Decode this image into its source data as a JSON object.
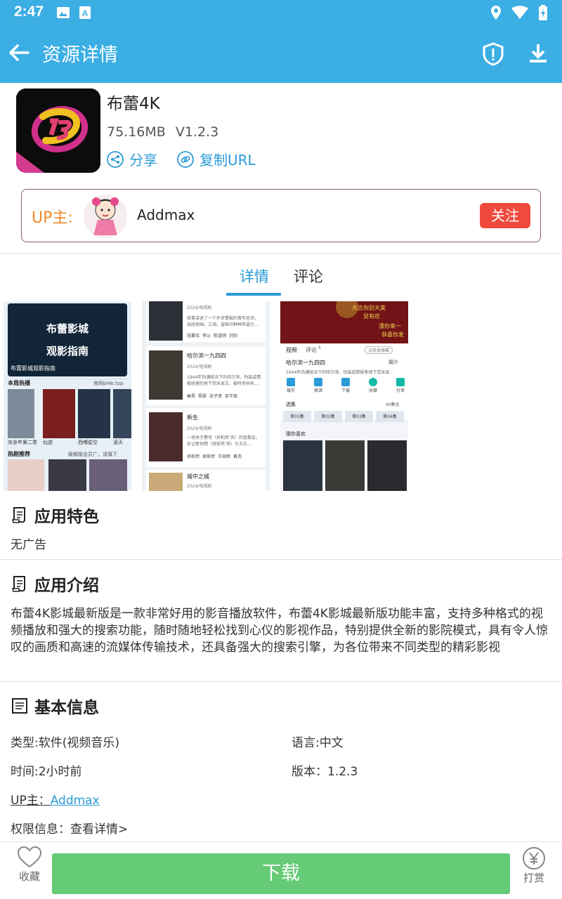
{
  "status_bar": {
    "time": "2:47"
  },
  "app_bar": {
    "title": "资源详情"
  },
  "app": {
    "name": "布蕾4K",
    "size": "75.16MB",
    "version": "V1.2.3",
    "share_label": "分享",
    "copy_url_label": "复制URL"
  },
  "uploader": {
    "label": "UP主:",
    "name": "Addmax",
    "follow_label": "关注"
  },
  "tabs": [
    {
      "label": "详情",
      "active": true
    },
    {
      "label": "评论",
      "active": false
    }
  ],
  "screenshots": {
    "shot1": {
      "banner_title": "布蕾影城",
      "banner_subtitle": "观影指南",
      "banner_caption": "布蕾影城观影指南",
      "hot_week": "本周热播",
      "site": "官网bl4k.top",
      "cards": [
        "庆余年第二季",
        "仙逆",
        "西嘈星空",
        "凌天"
      ],
      "recommend": "热剧推荐",
      "recommend_note": "破解版会员广，请慎下"
    },
    "shot2": {
      "items": [
        {
          "title": "",
          "meta": "2024/电视剧",
          "desc": "故事讲述了一个外世情报的青年总司，品经家国。江湖、盗匪间种种带盗引…",
          "tags": [
            "张翼伟",
            "李沁",
            "陈道明",
            "刘钧"
          ]
        },
        {
          "title": "哈尔滨一九四四",
          "meta": "2024/电视剧",
          "desc": "1944年伪满统治下的哈尔滨，伪装成情报经营的地下党宋卓文，被特务科科…",
          "tags": [
            "秦昊",
            "杨翠",
            "张子贤",
            "吴芊辰"
          ]
        },
        {
          "title": "新生",
          "meta": "2024/电视剧",
          "desc": "一场关于费可（井柏然 饰）的追悬会。女记者何晴（周依然 饰）与五位…",
          "tags": [
            "井柏然",
            "周依然",
            "王砚辉",
            "黄尧"
          ]
        },
        {
          "title": "城中之城",
          "meta": "2024/电视剧",
          "desc": "",
          "tags": []
        }
      ]
    },
    "shot3": {
      "danmaku": [
        "大吉你别大美",
        "吴有欢",
        "漂你来一",
        "恭喜你发"
      ],
      "tab_video": "视频",
      "tab_comment": "评论",
      "comment_count": "5",
      "danmaku_btn": "点我发弹幕",
      "title": "哈尔滨一九四四",
      "intro_label": "简介",
      "desc": "1944年伪满统治下的哈尔滨，伪装成情报者地下党宋卓…",
      "actions": [
        "缓存",
        "换源",
        "下载",
        "收藏",
        "分享"
      ],
      "episodes_label": "选集",
      "episodes_total": "40集全",
      "episodes": [
        "第01集",
        "第02集",
        "第03集",
        "第04集"
      ],
      "guess_label": "猜你喜欢"
    }
  },
  "features": {
    "title": "应用特色",
    "text": "无广告"
  },
  "intro": {
    "title": "应用介绍",
    "text": "布蕾4K影城最新版是一款非常好用的影音播放软件，布蕾4K影城最新版功能丰富，支持多种格式的视频播放和强大的搜索功能，随时随地轻松找到心仪的影视作品，特别提供全新的影院模式，具有令人惊叹的画质和高速的流媒体传输技术，还具备强大的搜索引擎，为各位带来不同类型的精彩影视"
  },
  "basic_info": {
    "title": "基本信息",
    "type": "类型:软件(视频音乐)",
    "language": "语言:中文",
    "time": "时间:2小时前",
    "version": "版本：1.2.3",
    "up_label": "UP主：",
    "up_name": "Addmax",
    "permission": "权限信息：查看详情>"
  },
  "bottom_bar": {
    "favorite_label": "收藏",
    "download_label": "下载",
    "tip_label": "打赏"
  },
  "colors": {
    "primary": "#3baee4",
    "link": "#2a9bd6",
    "follow": "#f04a3c",
    "download": "#65cb76",
    "up_label": "#f08a2c"
  }
}
